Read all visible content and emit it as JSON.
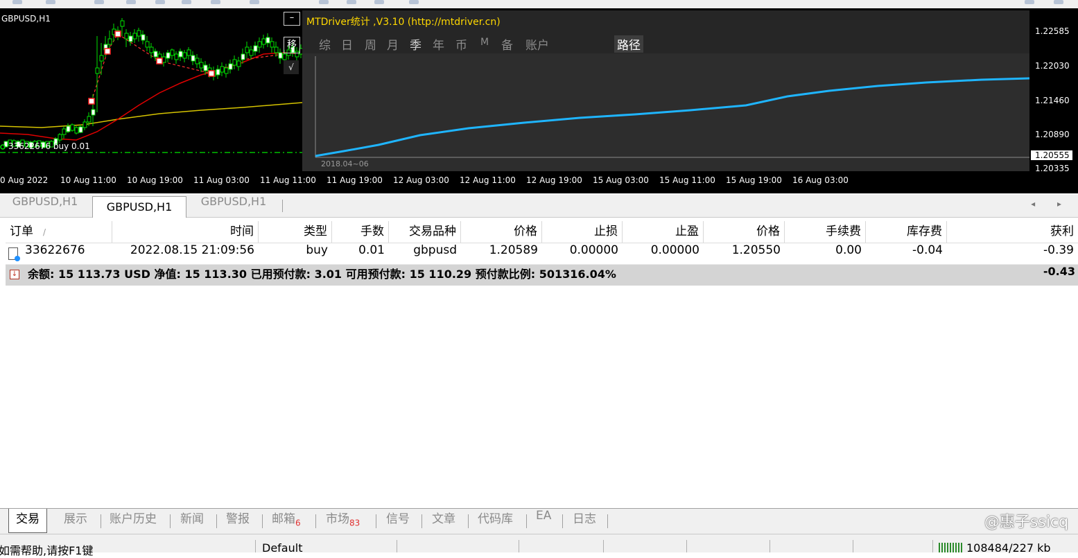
{
  "chart": {
    "symbol": "GBPUSD,H1",
    "order_label": "33622676 buy 0.01",
    "btn_minus": "–",
    "btn_move": "移",
    "btn_check": "√",
    "price_scale": [
      "1.22585",
      "1.22030",
      "1.21460",
      "1.20890",
      "1.20335"
    ],
    "current_price": "1.20555",
    "time_labels": [
      "0 Aug 2022",
      "10 Aug 11:00",
      "10 Aug 19:00",
      "11 Aug 03:00",
      "11 Aug 11:00",
      "11 Aug 19:00",
      "12 Aug 03:00",
      "12 Aug 11:00",
      "12 Aug 19:00",
      "15 Aug 03:00",
      "15 Aug 11:00",
      "15 Aug 19:00",
      "16 Aug 03:00"
    ]
  },
  "mtdriver": {
    "title": "MTDriver统计 ,V3.10 (http://mtdriver.cn)",
    "tabs": [
      "综",
      "日",
      "周",
      "月",
      "季",
      "年",
      "币",
      "M",
      "备",
      "账户"
    ],
    "active_tab": "季",
    "path_tab": "路径",
    "start_date": "2018.04~06",
    "line_color": "#1fb5ff"
  },
  "chart_tabs": [
    "GBPUSD,H1",
    "GBPUSD,H1",
    "GBPUSD,H1"
  ],
  "chart_tab_arrows": "◂ ▸",
  "table": {
    "headers": [
      "订单",
      "时间",
      "类型",
      "手数",
      "交易品种",
      "价格",
      "止损",
      "止盈",
      "价格",
      "手续费",
      "库存费",
      "获利"
    ],
    "sort_mark": "/",
    "row": [
      "33622676",
      "2022.08.15 21:09:56",
      "buy",
      "0.01",
      "gbpusd",
      "1.20589",
      "0.00000",
      "0.00000",
      "1.20550",
      "0.00",
      "-0.04",
      "-0.39"
    ],
    "summary": "余额: 15 113.73 USD  净值: 15 113.30  已用预付款: 3.01  可用预付款: 15 110.29  预付款比例: 501316.04%",
    "summary_profit": "-0.43"
  },
  "bottom_tabs": [
    {
      "label": "交易"
    },
    {
      "label": "展示"
    },
    {
      "label": "账户历史"
    },
    {
      "label": "新闻"
    },
    {
      "label": "警报"
    },
    {
      "label": "邮箱",
      "badge": "6"
    },
    {
      "label": "市场",
      "badge": "83"
    },
    {
      "label": "信号"
    },
    {
      "label": "文章"
    },
    {
      "label": "代码库"
    },
    {
      "label": "EA"
    },
    {
      "label": "日志"
    }
  ],
  "watermark": "@惠子ssicq",
  "status": {
    "help": "如需帮助,请按F1键",
    "profile": "Default",
    "traffic": "108484/227 kb"
  }
}
